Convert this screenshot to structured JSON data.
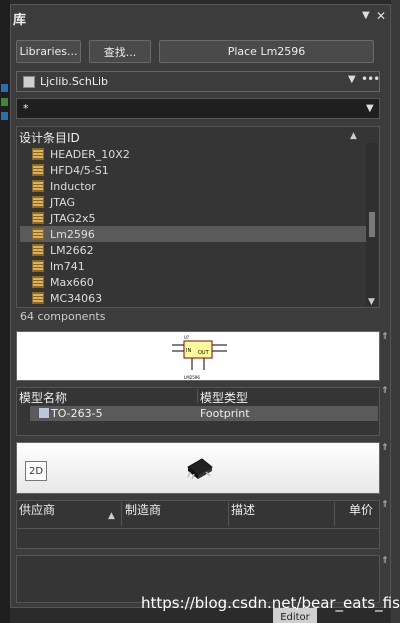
{
  "panel": {
    "title": "库"
  },
  "toolbar": {
    "libraries_label": "Libraries...",
    "search_label": "查找...",
    "place_label": "Place Lm2596"
  },
  "library": {
    "selected": "Ljclib.SchLib"
  },
  "filter": {
    "value": "*"
  },
  "components": {
    "column_header": "设计条目ID",
    "items": [
      "HEADER_10X2",
      "HFD4/5-S1",
      "Inductor",
      "JTAG",
      "JTAG2x5",
      "Lm2596",
      "LM2662",
      "lm741",
      "Max660",
      "MC34063"
    ],
    "selected": "Lm2596",
    "count_text": "64 components"
  },
  "preview": {
    "block_in": "IN",
    "block_out": "OUT",
    "part_label": "LM2596",
    "ref_label": "U?"
  },
  "models": {
    "col_name": "模型名称",
    "col_type": "模型类型",
    "rows": [
      {
        "name": "TO-263-5",
        "type": "Footprint"
      }
    ]
  },
  "footprint": {
    "view_button": "2D"
  },
  "suppliers": {
    "cols": [
      "供应商",
      "制造商",
      "描述",
      "单价"
    ]
  },
  "watermark": "https://blog.csdn.net/bear_eats_fish",
  "bottom_tab": "Editor",
  "colors": {
    "selection": "#5a5a5a",
    "panel_bg": "#3c3c3c",
    "chip": "#d8b35c"
  }
}
